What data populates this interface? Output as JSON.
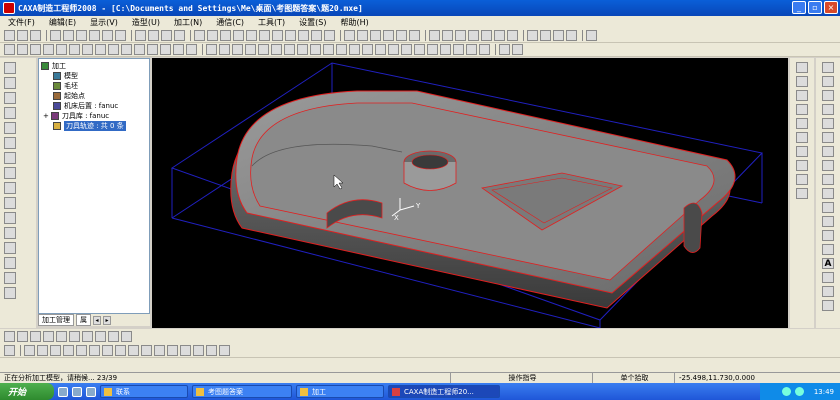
{
  "window": {
    "title": "CAXA制造工程师2008  - [C:\\Documents and Settings\\Me\\桌面\\考图题答案\\题20.mxe]"
  },
  "menu": [
    "文件(F)",
    "编辑(E)",
    "显示(V)",
    "造型(U)",
    "加工(N)",
    "通信(C)",
    "工具(T)",
    "设置(S)",
    "帮助(H)"
  ],
  "tree": {
    "items": [
      {
        "label": "加工",
        "level": 0,
        "icon_color": "#3a8a3a"
      },
      {
        "label": "模型",
        "level": 1,
        "icon_color": "#3a7a9a"
      },
      {
        "label": "毛坯",
        "level": 1,
        "icon_color": "#6a8a3a"
      },
      {
        "label": "起始点",
        "level": 1,
        "icon_color": "#9a6a3a"
      },
      {
        "label": "机床后置 : fanuc",
        "level": 1,
        "icon_color": "#4a4a9a"
      },
      {
        "label": "刀具库 : fanuc",
        "level": 1,
        "icon_color": "#7a3a7a"
      },
      {
        "label": "刀具轨迹 : 共 0 条",
        "level": 1,
        "icon_color": "#d8b040",
        "selected": true
      }
    ],
    "tabs": [
      "加工管理",
      "属"
    ]
  },
  "status": {
    "message": "正在分析加工模型，请稍候...  23/39",
    "hint": "操作指导",
    "mode": "单个拾取",
    "coords": "-25.498,11.730,0.000"
  },
  "taskbar": {
    "start": "开始",
    "items": [
      {
        "label": "联系",
        "active": false
      },
      {
        "label": "考图题答案",
        "active": false
      },
      {
        "label": "加工",
        "active": false
      },
      {
        "label": "CAXA制造工程师20...",
        "active": true
      }
    ],
    "clock": "13:49"
  },
  "colors": {
    "accent": "#0a5fd8",
    "viewport_bg": "#000000",
    "model_edges": "#e02020",
    "bounding_box": "#2020c0"
  }
}
